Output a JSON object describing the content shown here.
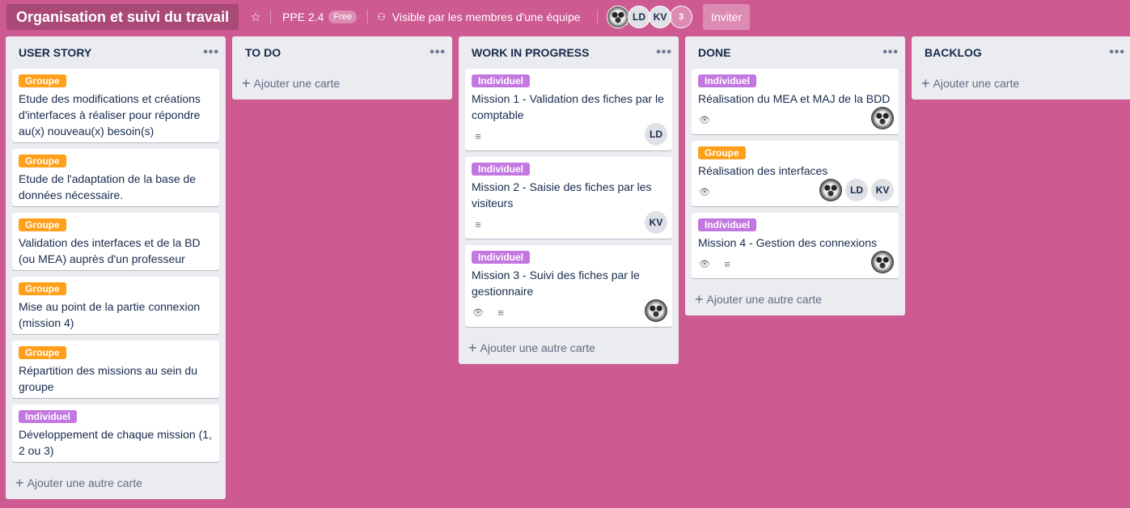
{
  "header": {
    "board_title": "Organisation et suivi du travail",
    "star_icon": "☆",
    "team_name": "PPE 2.4",
    "team_badge": "Free",
    "visibility_text": "Visible par les membres d'une équipe",
    "members": [
      "LD",
      "KV"
    ],
    "member_overflow": "3",
    "invite_label": "Inviter"
  },
  "colors": {
    "background": "#cd5a91",
    "label_groupe": "#ff9f1a",
    "label_individuel": "#c377e0"
  },
  "lists": [
    {
      "title": "USER STORY",
      "add_label": "Ajouter une autre carte",
      "cards": [
        {
          "label": "Groupe",
          "text": "Etude des modifications et créations d'interfaces à réaliser pour répondre au(x) nouveau(x) besoin(s)"
        },
        {
          "label": "Groupe",
          "text": "Etude de l'adaptation de la base de données nécessaire."
        },
        {
          "label": "Groupe",
          "text": "Validation des interfaces et de la BD (ou MEA) auprès d'un professeur"
        },
        {
          "label": "Groupe",
          "text": "Mise au point de la partie connexion (mission 4)"
        },
        {
          "label": "Groupe",
          "text": "Répartition des missions au sein du groupe"
        },
        {
          "label": "Individuel",
          "text": "Développement de chaque mission (1, 2 ou 3)"
        }
      ]
    },
    {
      "title": "TO DO",
      "add_label": "Ajouter une carte",
      "cards": []
    },
    {
      "title": "WORK IN PROGRESS",
      "add_label": "Ajouter une autre carte",
      "cards": [
        {
          "label": "Individuel",
          "text": "Mission 1 - Validation des fiches par le comptable",
          "member": "LD"
        },
        {
          "label": "Individuel",
          "text": "Mission 2 - Saisie des fiches par les visiteurs",
          "member": "KV"
        },
        {
          "label": "Individuel",
          "text": "Mission 3 - Suivi des fiches par le gestionnaire"
        }
      ]
    },
    {
      "title": "DONE",
      "add_label": "Ajouter une autre carte",
      "cards": [
        {
          "label": "Individuel",
          "text": "Réalisation du MEA et MAJ de la BDD"
        },
        {
          "label": "Groupe",
          "text": "Réalisation des interfaces",
          "members": [
            "LD",
            "KV"
          ]
        },
        {
          "label": "Individuel",
          "text": "Mission 4 - Gestion des connexions"
        }
      ]
    },
    {
      "title": "BACKLOG",
      "add_label": "Ajouter une carte",
      "cards": []
    }
  ],
  "icons": {
    "menu": "•••",
    "plus": "+",
    "eye": "👁",
    "description": "≡"
  }
}
